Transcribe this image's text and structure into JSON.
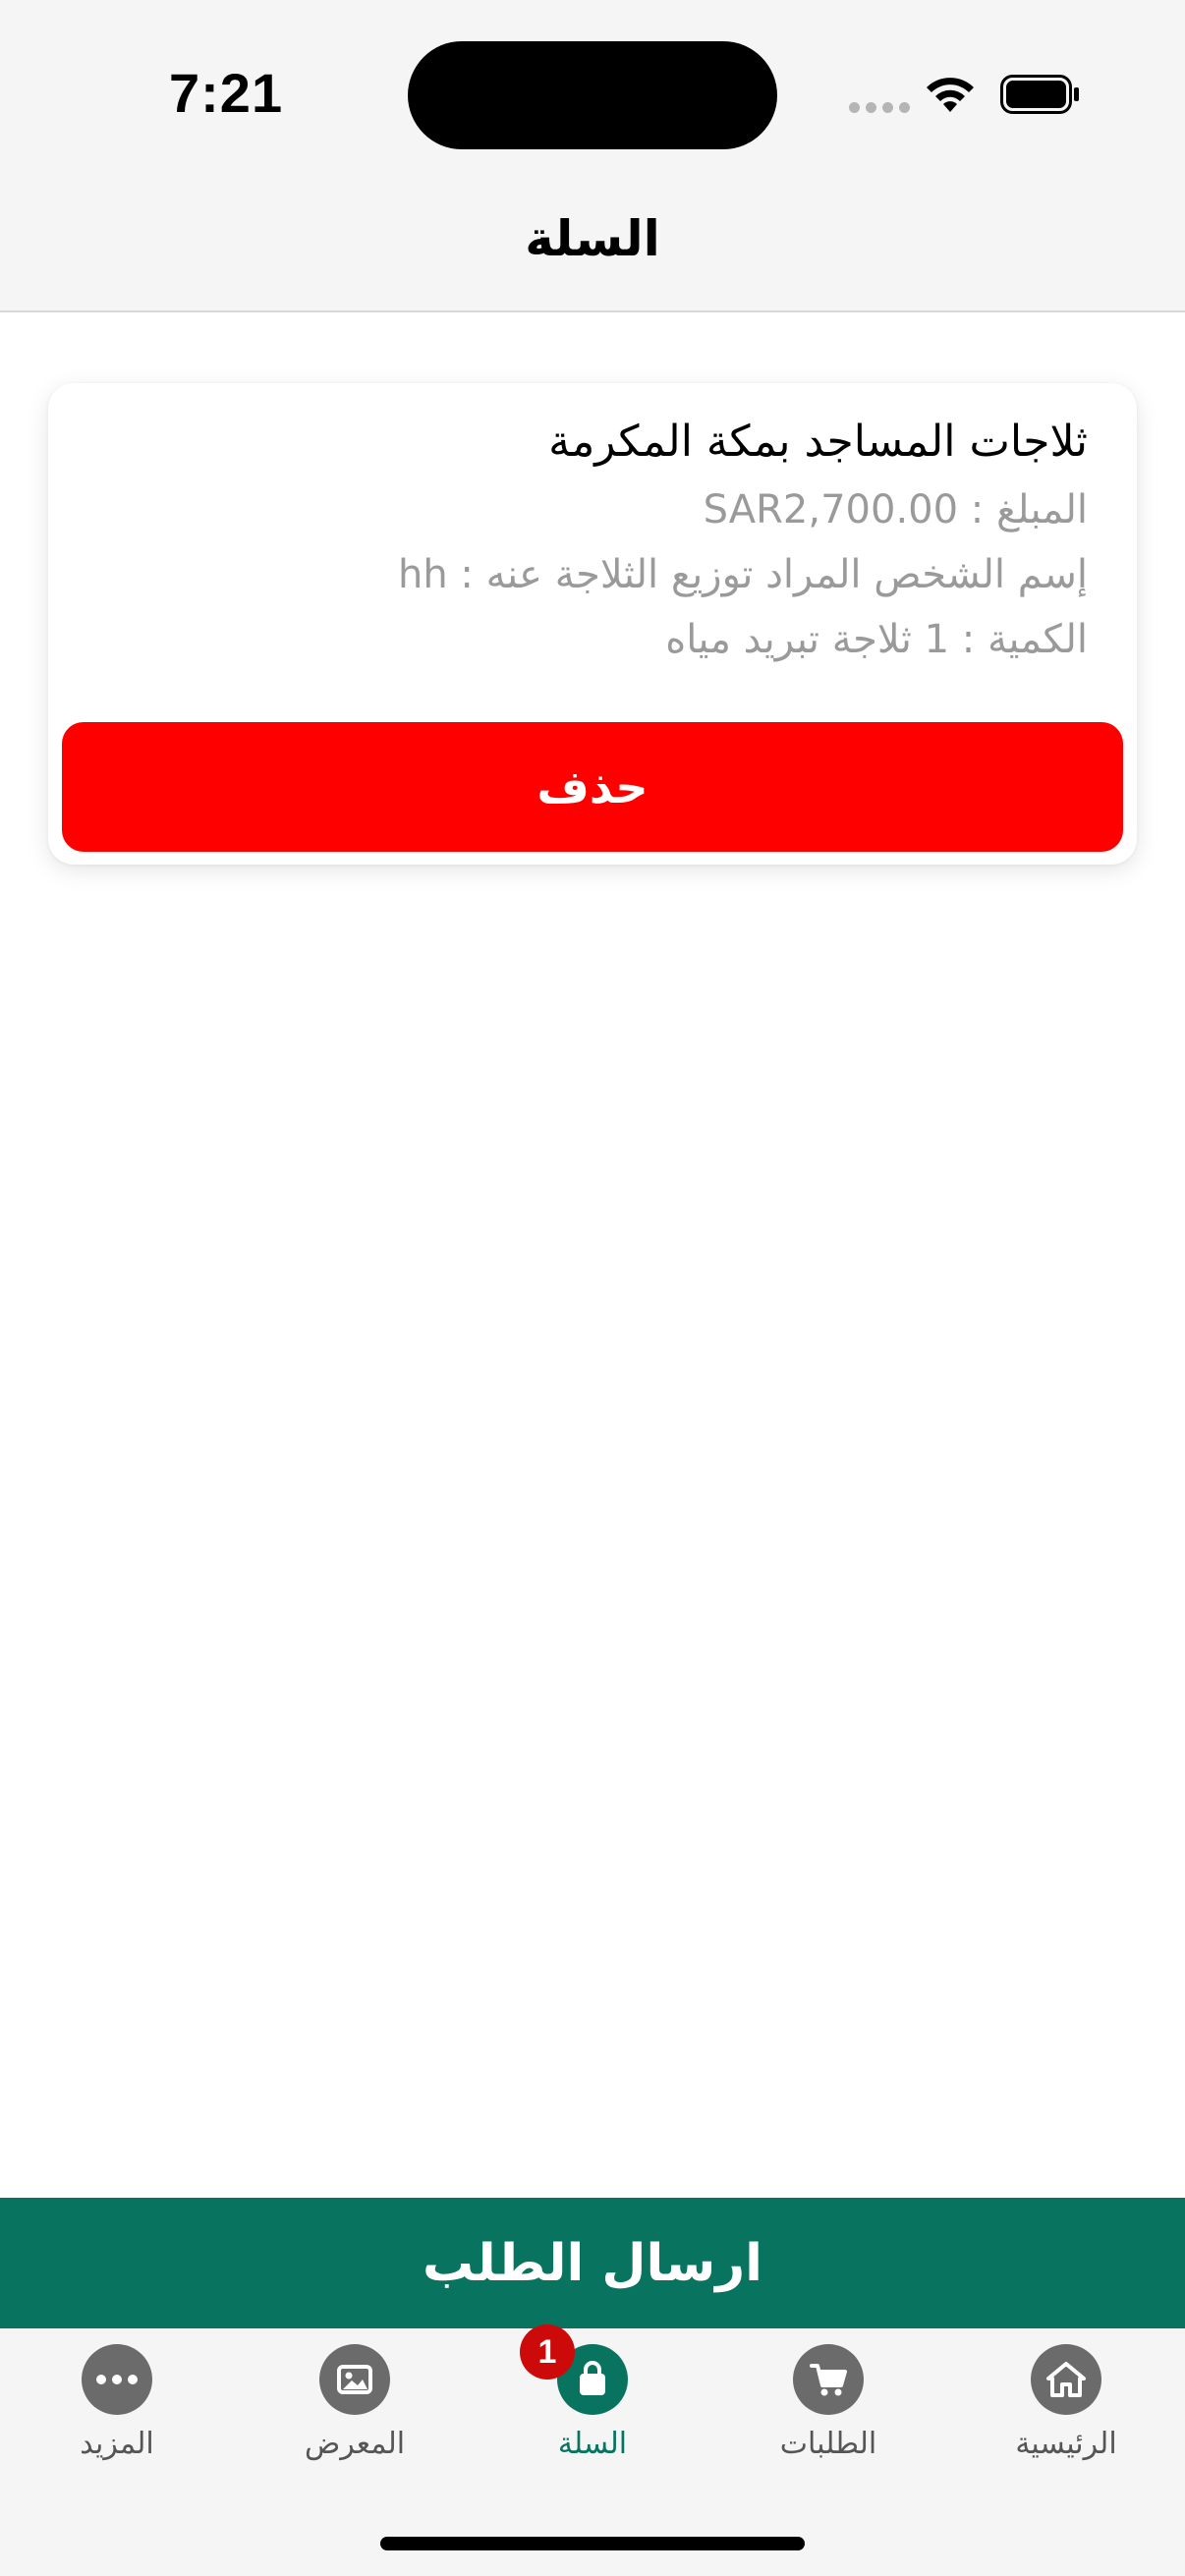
{
  "status_bar": {
    "time": "7:21"
  },
  "header": {
    "title": "السلة"
  },
  "cart_item": {
    "title": "ثلاجات المساجد بمكة المكرمة",
    "amount_label": "المبلغ : ",
    "amount_value": "SAR2,700.00",
    "person_label": "إسم الشخص المراد توزيع الثلاجة عنه : ",
    "person_value": "hh",
    "quantity_text": "الكمية : 1 ثلاجة تبريد مياه",
    "delete_label": "حذف"
  },
  "submit": {
    "label": "ارسال الطلب"
  },
  "tabs": [
    {
      "label": "الرئيسية",
      "icon": "home-icon"
    },
    {
      "label": "الطلبات",
      "icon": "cart-icon"
    },
    {
      "label": "السلة",
      "icon": "bag-icon",
      "badge": "1",
      "active": true
    },
    {
      "label": "المعرض",
      "icon": "image-icon"
    },
    {
      "label": "المزيد",
      "icon": "more-icon"
    }
  ],
  "colors": {
    "accent": "#08735f",
    "delete": "#ff0000",
    "badge": "#cc0a0a"
  }
}
